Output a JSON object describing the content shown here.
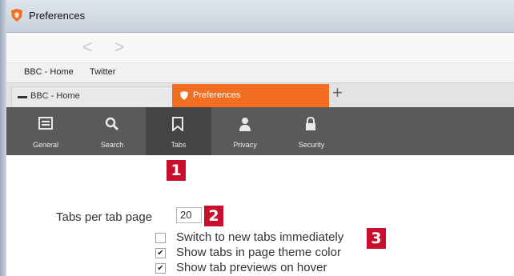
{
  "window": {
    "title": "Preferences"
  },
  "nav": {
    "back_glyph": "<",
    "forward_glyph": ">"
  },
  "bookmarks": [
    "BBC - Home",
    "Twitter"
  ],
  "tabs": [
    {
      "label": "BBC - Home",
      "active": false
    },
    {
      "label": "Preferences",
      "active": true
    }
  ],
  "new_tab_glyph": "+",
  "toolbar": {
    "items": [
      {
        "label": "General",
        "icon": "general-icon",
        "active": false
      },
      {
        "label": "Search",
        "icon": "search-icon",
        "active": false
      },
      {
        "label": "Tabs",
        "icon": "bookmark-icon",
        "active": true
      },
      {
        "label": "Privacy",
        "icon": "person-icon",
        "active": false
      },
      {
        "label": "Security",
        "icon": "lock-icon",
        "active": false
      }
    ]
  },
  "settings": {
    "tabs_per_page_label": "Tabs per tab page",
    "tabs_per_page_value": "20",
    "checkboxes": [
      {
        "label": "Switch to new tabs immediately",
        "checked": false
      },
      {
        "label": "Show tabs in page theme color",
        "checked": true
      },
      {
        "label": "Show tab previews on hover",
        "checked": true
      }
    ]
  },
  "callouts": [
    "1",
    "2",
    "3"
  ],
  "colors": {
    "active_tab": "#f26f21",
    "toolbar": "#5a5a5a",
    "toolbar_active": "#444444",
    "callout": "#c8102e"
  }
}
